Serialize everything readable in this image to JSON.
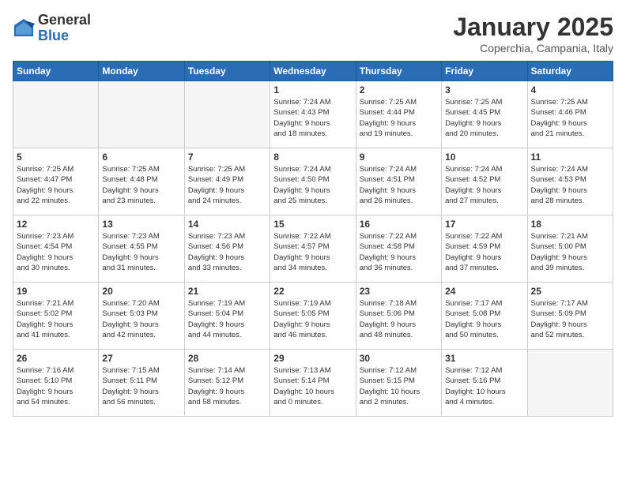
{
  "logo": {
    "general": "General",
    "blue": "Blue"
  },
  "title": "January 2025",
  "location": "Coperchia, Campania, Italy",
  "weekdays": [
    "Sunday",
    "Monday",
    "Tuesday",
    "Wednesday",
    "Thursday",
    "Friday",
    "Saturday"
  ],
  "weeks": [
    [
      {
        "day": "",
        "info": ""
      },
      {
        "day": "",
        "info": ""
      },
      {
        "day": "",
        "info": ""
      },
      {
        "day": "1",
        "info": "Sunrise: 7:24 AM\nSunset: 4:43 PM\nDaylight: 9 hours\nand 18 minutes."
      },
      {
        "day": "2",
        "info": "Sunrise: 7:25 AM\nSunset: 4:44 PM\nDaylight: 9 hours\nand 19 minutes."
      },
      {
        "day": "3",
        "info": "Sunrise: 7:25 AM\nSunset: 4:45 PM\nDaylight: 9 hours\nand 20 minutes."
      },
      {
        "day": "4",
        "info": "Sunrise: 7:25 AM\nSunset: 4:46 PM\nDaylight: 9 hours\nand 21 minutes."
      }
    ],
    [
      {
        "day": "5",
        "info": "Sunrise: 7:25 AM\nSunset: 4:47 PM\nDaylight: 9 hours\nand 22 minutes."
      },
      {
        "day": "6",
        "info": "Sunrise: 7:25 AM\nSunset: 4:48 PM\nDaylight: 9 hours\nand 23 minutes."
      },
      {
        "day": "7",
        "info": "Sunrise: 7:25 AM\nSunset: 4:49 PM\nDaylight: 9 hours\nand 24 minutes."
      },
      {
        "day": "8",
        "info": "Sunrise: 7:24 AM\nSunset: 4:50 PM\nDaylight: 9 hours\nand 25 minutes."
      },
      {
        "day": "9",
        "info": "Sunrise: 7:24 AM\nSunset: 4:51 PM\nDaylight: 9 hours\nand 26 minutes."
      },
      {
        "day": "10",
        "info": "Sunrise: 7:24 AM\nSunset: 4:52 PM\nDaylight: 9 hours\nand 27 minutes."
      },
      {
        "day": "11",
        "info": "Sunrise: 7:24 AM\nSunset: 4:53 PM\nDaylight: 9 hours\nand 28 minutes."
      }
    ],
    [
      {
        "day": "12",
        "info": "Sunrise: 7:23 AM\nSunset: 4:54 PM\nDaylight: 9 hours\nand 30 minutes."
      },
      {
        "day": "13",
        "info": "Sunrise: 7:23 AM\nSunset: 4:55 PM\nDaylight: 9 hours\nand 31 minutes."
      },
      {
        "day": "14",
        "info": "Sunrise: 7:23 AM\nSunset: 4:56 PM\nDaylight: 9 hours\nand 33 minutes."
      },
      {
        "day": "15",
        "info": "Sunrise: 7:22 AM\nSunset: 4:57 PM\nDaylight: 9 hours\nand 34 minutes."
      },
      {
        "day": "16",
        "info": "Sunrise: 7:22 AM\nSunset: 4:58 PM\nDaylight: 9 hours\nand 36 minutes."
      },
      {
        "day": "17",
        "info": "Sunrise: 7:22 AM\nSunset: 4:59 PM\nDaylight: 9 hours\nand 37 minutes."
      },
      {
        "day": "18",
        "info": "Sunrise: 7:21 AM\nSunset: 5:00 PM\nDaylight: 9 hours\nand 39 minutes."
      }
    ],
    [
      {
        "day": "19",
        "info": "Sunrise: 7:21 AM\nSunset: 5:02 PM\nDaylight: 9 hours\nand 41 minutes."
      },
      {
        "day": "20",
        "info": "Sunrise: 7:20 AM\nSunset: 5:03 PM\nDaylight: 9 hours\nand 42 minutes."
      },
      {
        "day": "21",
        "info": "Sunrise: 7:19 AM\nSunset: 5:04 PM\nDaylight: 9 hours\nand 44 minutes."
      },
      {
        "day": "22",
        "info": "Sunrise: 7:19 AM\nSunset: 5:05 PM\nDaylight: 9 hours\nand 46 minutes."
      },
      {
        "day": "23",
        "info": "Sunrise: 7:18 AM\nSunset: 5:06 PM\nDaylight: 9 hours\nand 48 minutes."
      },
      {
        "day": "24",
        "info": "Sunrise: 7:17 AM\nSunset: 5:08 PM\nDaylight: 9 hours\nand 50 minutes."
      },
      {
        "day": "25",
        "info": "Sunrise: 7:17 AM\nSunset: 5:09 PM\nDaylight: 9 hours\nand 52 minutes."
      }
    ],
    [
      {
        "day": "26",
        "info": "Sunrise: 7:16 AM\nSunset: 5:10 PM\nDaylight: 9 hours\nand 54 minutes."
      },
      {
        "day": "27",
        "info": "Sunrise: 7:15 AM\nSunset: 5:11 PM\nDaylight: 9 hours\nand 56 minutes."
      },
      {
        "day": "28",
        "info": "Sunrise: 7:14 AM\nSunset: 5:12 PM\nDaylight: 9 hours\nand 58 minutes."
      },
      {
        "day": "29",
        "info": "Sunrise: 7:13 AM\nSunset: 5:14 PM\nDaylight: 10 hours\nand 0 minutes."
      },
      {
        "day": "30",
        "info": "Sunrise: 7:12 AM\nSunset: 5:15 PM\nDaylight: 10 hours\nand 2 minutes."
      },
      {
        "day": "31",
        "info": "Sunrise: 7:12 AM\nSunset: 5:16 PM\nDaylight: 10 hours\nand 4 minutes."
      },
      {
        "day": "",
        "info": ""
      }
    ]
  ]
}
